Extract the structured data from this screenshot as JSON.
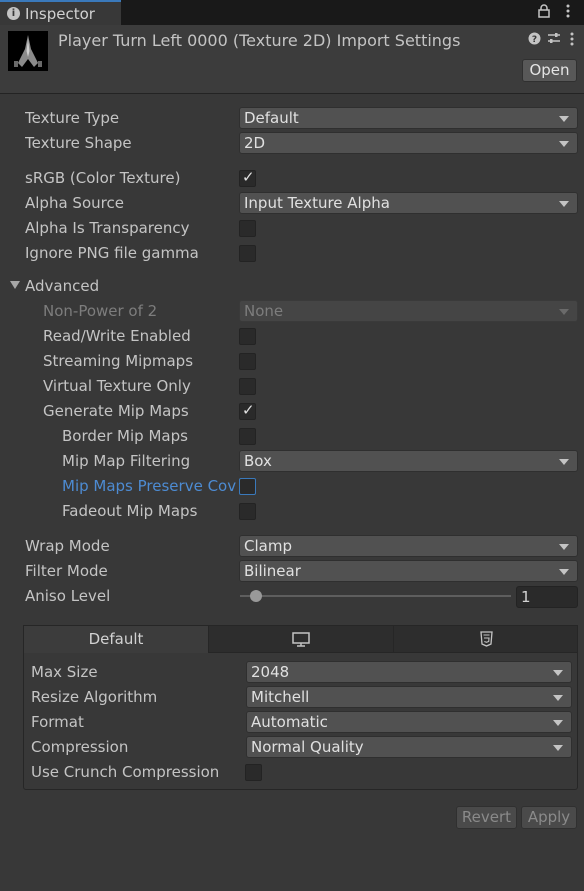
{
  "tab": {
    "title": "Inspector"
  },
  "header": {
    "title": "Player Turn Left 0000 (Texture 2D) Import Settings",
    "open_label": "Open"
  },
  "fields": {
    "texture_type": {
      "label": "Texture Type",
      "value": "Default"
    },
    "texture_shape": {
      "label": "Texture Shape",
      "value": "2D"
    },
    "srgb": {
      "label": "sRGB (Color Texture)",
      "checked": true
    },
    "alpha_source": {
      "label": "Alpha Source",
      "value": "Input Texture Alpha"
    },
    "alpha_is_transparency": {
      "label": "Alpha Is Transparency",
      "checked": false
    },
    "ignore_png_gamma": {
      "label": "Ignore PNG file gamma",
      "checked": false
    },
    "advanced": {
      "label": "Advanced"
    },
    "non_power_of_2": {
      "label": "Non-Power of 2",
      "value": "None"
    },
    "read_write": {
      "label": "Read/Write Enabled",
      "checked": false
    },
    "streaming_mipmaps": {
      "label": "Streaming Mipmaps",
      "checked": false
    },
    "virtual_texture_only": {
      "label": "Virtual Texture Only",
      "checked": false
    },
    "generate_mip_maps": {
      "label": "Generate Mip Maps",
      "checked": true
    },
    "border_mip_maps": {
      "label": "Border Mip Maps",
      "checked": false
    },
    "mip_map_filtering": {
      "label": "Mip Map Filtering",
      "value": "Box"
    },
    "mip_maps_preserve_coverage": {
      "label": "Mip Maps Preserve Cove",
      "checked": false
    },
    "fadeout_mip_maps": {
      "label": "Fadeout Mip Maps",
      "checked": false
    },
    "wrap_mode": {
      "label": "Wrap Mode",
      "value": "Clamp"
    },
    "filter_mode": {
      "label": "Filter Mode",
      "value": "Bilinear"
    },
    "aniso_level": {
      "label": "Aniso Level",
      "value": "1",
      "slider_fraction": 0.06
    }
  },
  "platform": {
    "tabs": [
      {
        "label": "Default",
        "icon": "none"
      },
      {
        "label": "",
        "icon": "monitor-icon"
      },
      {
        "label": "",
        "icon": "html5-icon"
      }
    ],
    "max_size": {
      "label": "Max Size",
      "value": "2048"
    },
    "resize_algorithm": {
      "label": "Resize Algorithm",
      "value": "Mitchell"
    },
    "format": {
      "label": "Format",
      "value": "Automatic"
    },
    "compression": {
      "label": "Compression",
      "value": "Normal Quality"
    },
    "use_crunch": {
      "label": "Use Crunch Compression",
      "checked": false
    }
  },
  "footer": {
    "revert_label": "Revert",
    "apply_label": "Apply"
  },
  "colors": {
    "background": "#383838",
    "tab_bar": "#191919",
    "accent_blue": "#3a79bb",
    "link_blue": "#4d8bd2"
  }
}
